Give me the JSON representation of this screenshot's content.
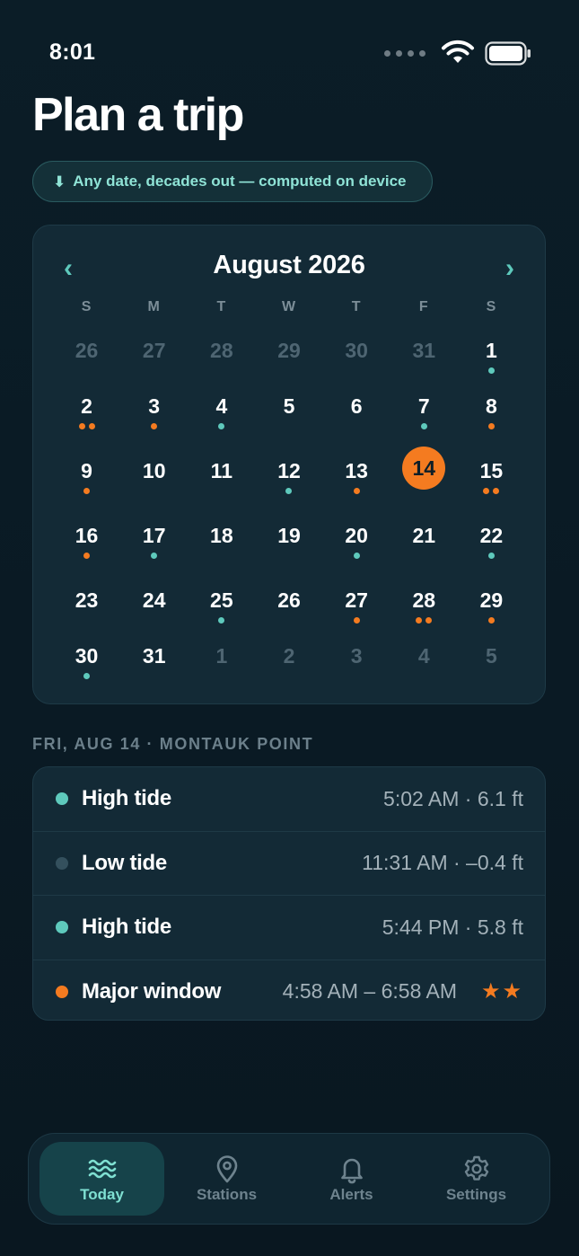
{
  "status_bar": {
    "time": "8:01"
  },
  "page": {
    "title": "Plan a trip",
    "info_pill": {
      "arrow": "⬇",
      "text": "Any date, decades out — computed on device"
    }
  },
  "calendar": {
    "month_label": "August 2026",
    "prev_symbol": "‹",
    "next_symbol": "›",
    "weekdays": [
      "S",
      "M",
      "T",
      "W",
      "T",
      "F",
      "S"
    ],
    "weeks": [
      [
        {
          "d": "26",
          "m": true
        },
        {
          "d": "27",
          "m": true
        },
        {
          "d": "28",
          "m": true
        },
        {
          "d": "29",
          "m": true
        },
        {
          "d": "30",
          "m": true
        },
        {
          "d": "31",
          "m": true
        },
        {
          "d": "1",
          "dots": [
            "teal"
          ]
        }
      ],
      [
        {
          "d": "2",
          "dots": [
            "orange",
            "orange"
          ]
        },
        {
          "d": "3",
          "dots": [
            "orange"
          ]
        },
        {
          "d": "4",
          "dots": [
            "teal"
          ]
        },
        {
          "d": "5"
        },
        {
          "d": "6"
        },
        {
          "d": "7",
          "dots": [
            "teal"
          ]
        },
        {
          "d": "8",
          "dots": [
            "orange"
          ]
        }
      ],
      [
        {
          "d": "9",
          "dots": [
            "orange"
          ]
        },
        {
          "d": "10"
        },
        {
          "d": "11"
        },
        {
          "d": "12",
          "dots": [
            "teal"
          ]
        },
        {
          "d": "13",
          "dots": [
            "orange"
          ]
        },
        {
          "d": "14",
          "selected": true
        },
        {
          "d": "15",
          "dots": [
            "orange",
            "orange"
          ]
        }
      ],
      [
        {
          "d": "16",
          "dots": [
            "orange"
          ]
        },
        {
          "d": "17",
          "dots": [
            "teal"
          ]
        },
        {
          "d": "18"
        },
        {
          "d": "19"
        },
        {
          "d": "20",
          "dots": [
            "teal"
          ]
        },
        {
          "d": "21"
        },
        {
          "d": "22",
          "dots": [
            "teal"
          ]
        }
      ],
      [
        {
          "d": "23"
        },
        {
          "d": "24"
        },
        {
          "d": "25",
          "dots": [
            "teal"
          ]
        },
        {
          "d": "26"
        },
        {
          "d": "27",
          "dots": [
            "orange"
          ]
        },
        {
          "d": "28",
          "dots": [
            "orange",
            "orange"
          ]
        },
        {
          "d": "29",
          "dots": [
            "orange"
          ]
        }
      ],
      [
        {
          "d": "30",
          "dots": [
            "teal"
          ]
        },
        {
          "d": "31"
        },
        {
          "d": "1",
          "m": true
        },
        {
          "d": "2",
          "m": true
        },
        {
          "d": "3",
          "m": true
        },
        {
          "d": "4",
          "m": true
        },
        {
          "d": "5",
          "m": true
        }
      ]
    ]
  },
  "day_detail": {
    "label": "FRI, AUG 14 · MONTAUK POINT",
    "events": [
      {
        "name": "High tide",
        "value": "5:02 AM · 6.1 ft",
        "marker": "teal"
      },
      {
        "name": "Low tide",
        "value": "11:31 AM · –0.4 ft",
        "marker": "slate"
      },
      {
        "name": "High tide",
        "value": "5:44 PM · 5.8 ft",
        "marker": "teal"
      },
      {
        "name": "Major window",
        "value": "4:58 AM – 6:58 AM",
        "marker": "orange",
        "stars": "★★"
      }
    ]
  },
  "tabs": [
    {
      "label": "Today",
      "icon": "waves-icon",
      "active": true
    },
    {
      "label": "Stations",
      "icon": "location-pin-icon",
      "active": false
    },
    {
      "label": "Alerts",
      "icon": "bell-icon",
      "active": false
    },
    {
      "label": "Settings",
      "icon": "gear-icon",
      "active": false
    }
  ],
  "colors": {
    "background": "#0b1d27",
    "card": "#132a36",
    "accent_teal": "#5ec9bc",
    "accent_orange": "#f47b20",
    "muted_text": "#7c8e98"
  }
}
